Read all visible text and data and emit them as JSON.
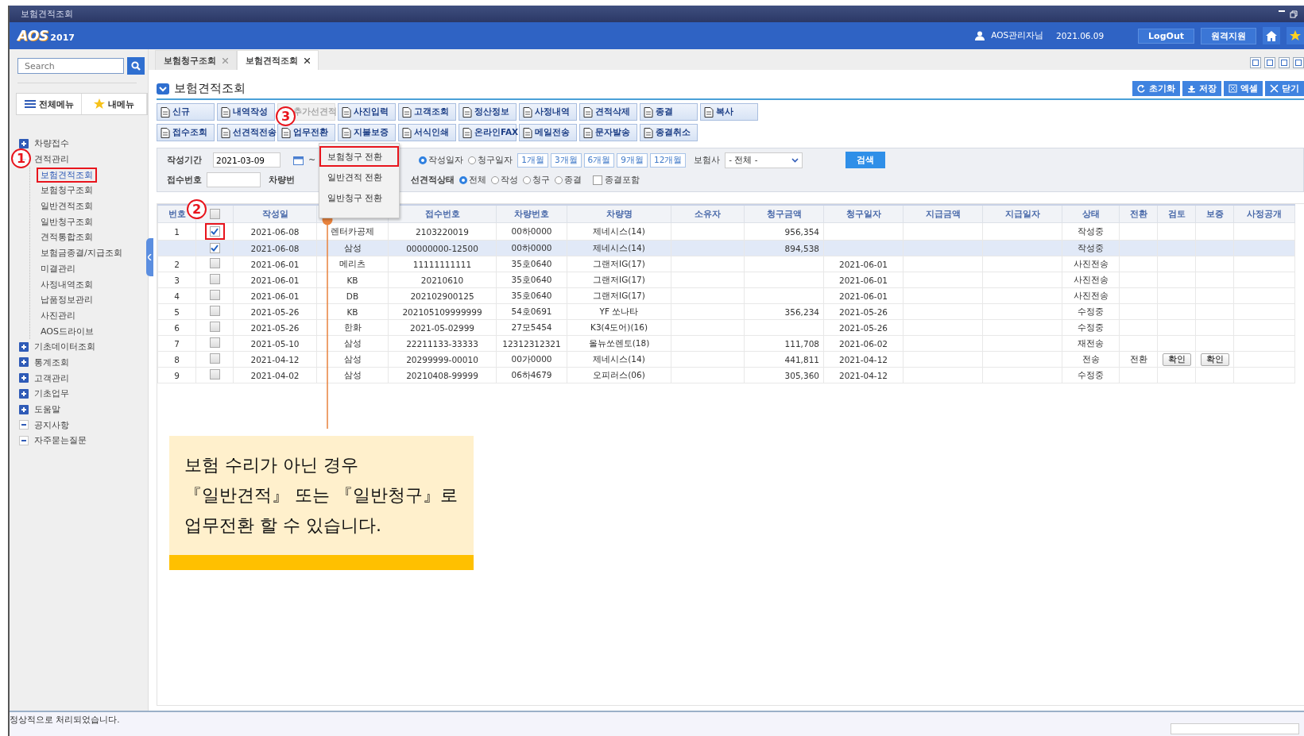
{
  "window": {
    "title": "보험견적조회"
  },
  "header": {
    "logo": "AOS",
    "logo_year": "2017",
    "user": "AOS관리자님",
    "date": "2021.06.09",
    "buttons": [
      "LogOut",
      "원격지원"
    ]
  },
  "sidebar": {
    "search": {
      "placeholder": "Search"
    },
    "menu_buttons": [
      {
        "label": "전체메뉴",
        "kind": "list"
      },
      {
        "label": "내메뉴",
        "kind": "star"
      }
    ],
    "tree": [
      {
        "label": "차량접수",
        "expanded": false
      },
      {
        "label": "견적관리",
        "expanded": true,
        "marker": "1",
        "children": [
          {
            "label": "보험견적조회",
            "selected": true,
            "highlighted": true
          },
          {
            "label": "보험청구조회",
            "selected": false,
            "highlighted": false
          },
          {
            "label": "일반견적조회",
            "selected": false,
            "highlighted": false
          },
          {
            "label": "일반청구조회",
            "selected": false,
            "highlighted": false
          },
          {
            "label": "견적통합조회",
            "selected": false,
            "highlighted": false
          },
          {
            "label": "보험금종결/지급조회",
            "selected": false,
            "highlighted": false
          },
          {
            "label": "미결관리",
            "selected": false,
            "highlighted": false
          },
          {
            "label": "사정내역조회",
            "selected": false,
            "highlighted": false
          },
          {
            "label": "납품정보관리",
            "selected": false,
            "highlighted": false
          },
          {
            "label": "사진관리",
            "selected": false,
            "highlighted": false
          },
          {
            "label": "AOS드라이브",
            "selected": false,
            "highlighted": false
          }
        ]
      },
      {
        "label": "기초데이터조회",
        "expanded": false
      },
      {
        "label": "통계조회",
        "expanded": false
      },
      {
        "label": "고객관리",
        "expanded": false
      },
      {
        "label": "기초업무",
        "expanded": false
      },
      {
        "label": "도움말",
        "expanded": false
      },
      {
        "label": "공지사항",
        "expanded": true
      },
      {
        "label": "자주묻는질문",
        "expanded": true
      }
    ]
  },
  "tabs": [
    {
      "label": "보험청구조회",
      "selected": false
    },
    {
      "label": "보험견적조회",
      "selected": true
    }
  ],
  "page": {
    "title": "보험견적조회",
    "actions": [
      {
        "label": "초기화",
        "kind": "refresh"
      },
      {
        "label": "저장",
        "kind": "save"
      },
      {
        "label": "엑셀",
        "kind": "excel"
      },
      {
        "label": "닫기",
        "kind": "close"
      }
    ]
  },
  "toolbar": [
    [
      {
        "label": "신규",
        "disabled": false
      },
      {
        "label": "내역작성",
        "disabled": false
      },
      {
        "label": "추가선견적",
        "disabled": true
      },
      {
        "label": "사진입력",
        "disabled": false
      },
      {
        "label": "고객조회",
        "disabled": false
      },
      {
        "label": "정산정보",
        "disabled": false
      },
      {
        "label": "사정내역",
        "disabled": false
      },
      {
        "label": "견적삭제",
        "disabled": false
      },
      {
        "label": "종결",
        "disabled": false
      },
      {
        "label": "복사",
        "disabled": false
      }
    ],
    [
      {
        "label": "접수조회",
        "disabled": false
      },
      {
        "label": "선견적전송",
        "disabled": false
      },
      {
        "label": "업무전환",
        "disabled": false,
        "marker": "3",
        "menu": {
          "items": [
            {
              "label": "보험청구 전환",
              "highlighted": true
            },
            {
              "label": "일반견적 전환",
              "highlighted": false
            },
            {
              "label": "일반청구 전환",
              "highlighted": false
            }
          ]
        }
      },
      {
        "label": "지불보증",
        "disabled": false
      },
      {
        "label": "서식인쇄",
        "disabled": false
      },
      {
        "label": "온라인FAX",
        "disabled": false
      },
      {
        "label": "메일전송",
        "disabled": false
      },
      {
        "label": "문자발송",
        "disabled": false
      },
      {
        "label": "종결취소",
        "disabled": false
      }
    ]
  ],
  "filter": {
    "period_label": "작성기간",
    "start_date": "2021-03-09",
    "range_sep": "~",
    "date_types": [
      {
        "label": "작성일자",
        "selected": true
      },
      {
        "label": "청구일자",
        "selected": false
      }
    ],
    "periods": [
      "1개월",
      "3개월",
      "6개월",
      "9개월",
      "12개월"
    ],
    "insurer_label": "보험사",
    "insurer_value": "- 전체 -",
    "search_button": "검색",
    "receipt_label": "접수번호",
    "plate_label": "차량번",
    "status_label": "선견적상태",
    "statuses": [
      {
        "label": "전체",
        "selected": true
      },
      {
        "label": "작성",
        "selected": false
      },
      {
        "label": "청구",
        "selected": false
      },
      {
        "label": "종결",
        "selected": false
      }
    ],
    "include_closed": {
      "label": "종결포함",
      "checked": false
    }
  },
  "table": {
    "columns": [
      {
        "label": "번호"
      },
      {
        "kind": "check",
        "checked": false
      },
      {
        "label": "작성일"
      },
      {},
      {
        "label": "접수번호"
      },
      {
        "label": "차량번호"
      },
      {
        "label": "차량명"
      },
      {
        "label": "소유자"
      },
      {
        "label": "청구금액"
      },
      {
        "label": "청구일자"
      },
      {
        "label": "지급금액"
      },
      {
        "label": "지급일자"
      },
      {
        "label": "상태"
      },
      {
        "label": "전환"
      },
      {
        "label": "검토",
        "kind": "button"
      },
      {
        "label": "보증",
        "kind": "button"
      },
      {
        "label": "사정공개"
      }
    ],
    "rows": [
      {
        "checked": true,
        "highlighted": true,
        "marker": "2",
        "selected": false,
        "cells": [
          "1",
          null,
          "2021-06-08",
          "렌터카공제",
          "2103220019",
          "00하0000",
          "제네시스(14)",
          null,
          "956,354",
          null,
          null,
          null,
          "작성중",
          null,
          null,
          null,
          null
        ]
      },
      {
        "checked": true,
        "highlighted": false,
        "selected": true,
        "cells": [
          null,
          null,
          "2021-06-08",
          "삼성",
          "00000000-12500",
          "00하0000",
          "제네시스(14)",
          null,
          "894,538",
          null,
          null,
          null,
          "작성중",
          null,
          null,
          null,
          null
        ]
      },
      {
        "checked": false,
        "highlighted": false,
        "selected": false,
        "cells": [
          "2",
          null,
          "2021-06-01",
          "메리츠",
          "11111111111",
          "35호0640",
          "그랜저IG(17)",
          null,
          null,
          "2021-06-01",
          null,
          null,
          "사진전송",
          null,
          null,
          null,
          null
        ]
      },
      {
        "checked": false,
        "highlighted": false,
        "selected": false,
        "cells": [
          "3",
          null,
          "2021-06-01",
          "KB",
          "20210610",
          "35호0640",
          "그랜저IG(17)",
          null,
          null,
          "2021-06-01",
          null,
          null,
          "사진전송",
          null,
          null,
          null,
          null
        ]
      },
      {
        "checked": false,
        "highlighted": false,
        "selected": false,
        "cells": [
          "4",
          null,
          "2021-06-01",
          "DB",
          "202102900125",
          "35호0640",
          "그랜저IG(17)",
          null,
          null,
          "2021-06-01",
          null,
          null,
          "사진전송",
          null,
          null,
          null,
          null
        ]
      },
      {
        "checked": false,
        "highlighted": false,
        "selected": false,
        "cells": [
          "5",
          null,
          "2021-05-26",
          "KB",
          "202105109999999",
          "54호0691",
          "YF 쏘나타",
          null,
          "356,234",
          "2021-05-26",
          null,
          null,
          "수정중",
          null,
          null,
          null,
          null
        ]
      },
      {
        "checked": false,
        "highlighted": false,
        "selected": false,
        "cells": [
          "6",
          null,
          "2021-05-26",
          "한화",
          "2021-05-02999",
          "27모5454",
          "K3(4도어)(16)",
          null,
          null,
          "2021-05-26",
          null,
          null,
          "수정중",
          null,
          null,
          null,
          null
        ]
      },
      {
        "checked": false,
        "highlighted": false,
        "selected": false,
        "cells": [
          "7",
          null,
          "2021-05-10",
          "삼성",
          "22211133-33333",
          "12312312321",
          "올뉴쏘렌토(18)",
          null,
          "111,708",
          "2021-06-02",
          null,
          null,
          "재전송",
          null,
          null,
          null,
          null
        ]
      },
      {
        "checked": false,
        "highlighted": false,
        "selected": false,
        "cells": [
          "8",
          null,
          "2021-04-12",
          "삼성",
          "20299999-00010",
          "00가0000",
          "제네시스(14)",
          null,
          "441,811",
          "2021-04-12",
          null,
          null,
          "전송",
          "전환",
          "확인",
          "확인",
          null
        ]
      },
      {
        "checked": false,
        "highlighted": false,
        "selected": false,
        "cells": [
          "9",
          null,
          "2021-04-02",
          "삼성",
          "20210408-99999",
          "06하4679",
          "오피러스(06)",
          null,
          "305,360",
          "2021-04-12",
          null,
          null,
          "수정중",
          null,
          null,
          null,
          null
        ]
      }
    ]
  },
  "callout": {
    "text": "보험 수리가 아닌 경우 『일반견적』 또는 『일반청구』로 업무전환 할 수 있습니다."
  },
  "status_bar": {
    "message": "정상적으로 처리되었습니다."
  }
}
